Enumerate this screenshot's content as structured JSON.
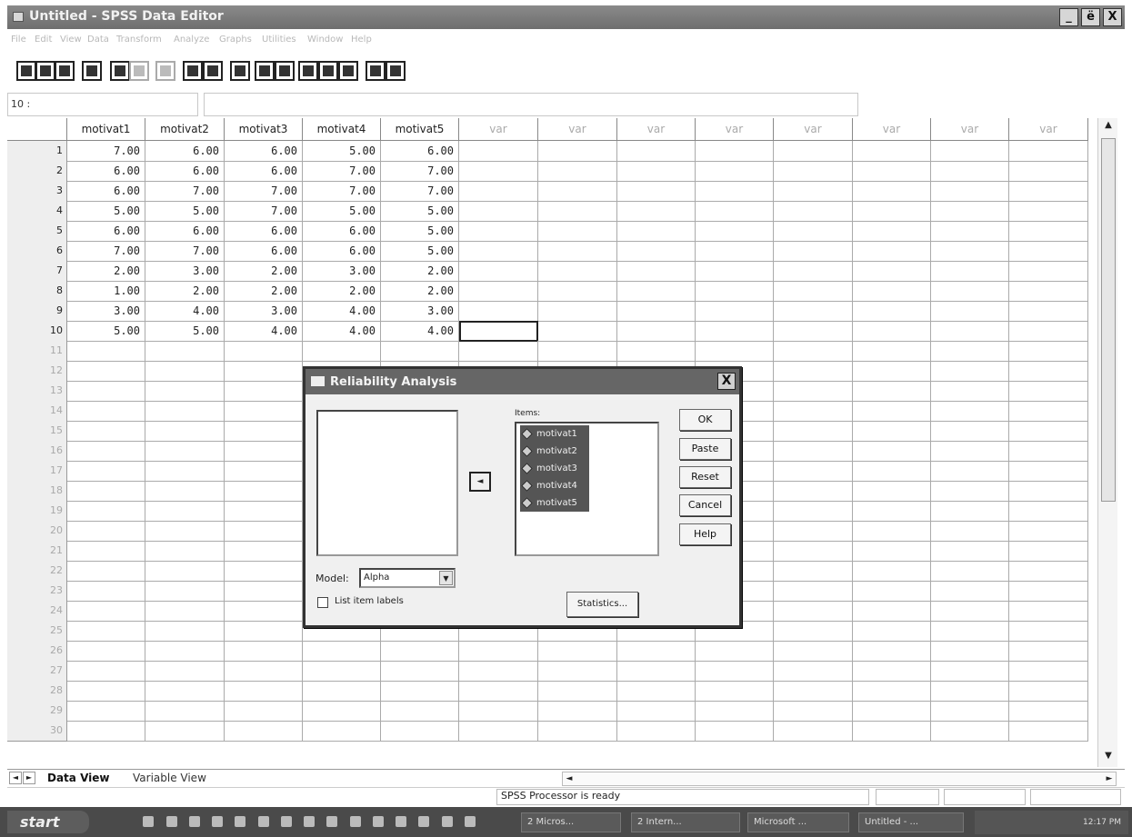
{
  "window": {
    "title": "Untitled - SPSS Data Editor",
    "minimize_label": "_",
    "maximize_label": "ё",
    "close_label": "X"
  },
  "menu": [
    "File",
    "Edit",
    "View",
    "Data",
    "Transform",
    "Analyze",
    "Graphs",
    "Utilities",
    "Window",
    "Help"
  ],
  "toolbar_icons": [
    "open-icon",
    "save-icon",
    "print-icon",
    "dialog-recall-icon",
    "undo-icon",
    "redo-icon",
    "goto-chart-icon",
    "goto-case-icon",
    "variables-icon",
    "find-icon",
    "insert-case-icon",
    "insert-variable-icon",
    "split-file-icon",
    "weight-cases-icon",
    "select-cases-icon",
    "value-labels-icon",
    "use-sets-icon"
  ],
  "cell_reference": "10 :",
  "grid": {
    "columns": [
      "motivat1",
      "motivat2",
      "motivat3",
      "motivat4",
      "motivat5",
      "var",
      "var",
      "var",
      "var",
      "var",
      "var",
      "var",
      "var"
    ],
    "row_numbers": [
      "1",
      "2",
      "3",
      "4",
      "5",
      "6",
      "7",
      "8",
      "9",
      "10",
      "11",
      "12",
      "13",
      "14",
      "15",
      "16",
      "17",
      "18",
      "19",
      "20",
      "21",
      "22",
      "23",
      "24",
      "25",
      "26",
      "27",
      "28",
      "29",
      "30"
    ],
    "rows": [
      [
        "7.00",
        "6.00",
        "6.00",
        "5.00",
        "6.00"
      ],
      [
        "6.00",
        "6.00",
        "6.00",
        "7.00",
        "7.00"
      ],
      [
        "6.00",
        "7.00",
        "7.00",
        "7.00",
        "7.00"
      ],
      [
        "5.00",
        "5.00",
        "7.00",
        "5.00",
        "5.00"
      ],
      [
        "6.00",
        "6.00",
        "6.00",
        "6.00",
        "5.00"
      ],
      [
        "7.00",
        "7.00",
        "6.00",
        "6.00",
        "5.00"
      ],
      [
        "2.00",
        "3.00",
        "2.00",
        "3.00",
        "2.00"
      ],
      [
        "1.00",
        "2.00",
        "2.00",
        "2.00",
        "2.00"
      ],
      [
        "3.00",
        "4.00",
        "3.00",
        "4.00",
        "3.00"
      ],
      [
        "5.00",
        "5.00",
        "4.00",
        "4.00",
        "4.00"
      ]
    ]
  },
  "tabs": {
    "data_view": "Data View",
    "variable_view": "Variable View"
  },
  "status": {
    "text": "SPSS Processor  is ready"
  },
  "taskbar": {
    "start_label": "start",
    "tasks": [
      "2 Micros...",
      "2 Intern...",
      "Microsoft ...",
      "Untitled - ..."
    ],
    "clock": "12:17 PM"
  },
  "dialog": {
    "title": "Reliability Analysis",
    "close_label": "X",
    "items_label": "Items:",
    "items": [
      "motivat1",
      "motivat2",
      "motivat3",
      "motivat4",
      "motivat5"
    ],
    "buttons": {
      "ok": "OK",
      "paste": "Paste",
      "reset": "Reset",
      "cancel": "Cancel",
      "help": "Help",
      "statistics": "Statistics..."
    },
    "model_label": "Model:",
    "model_value": "Alpha",
    "list_item_labels": "List item labels",
    "list_item_labels_checked": false
  }
}
